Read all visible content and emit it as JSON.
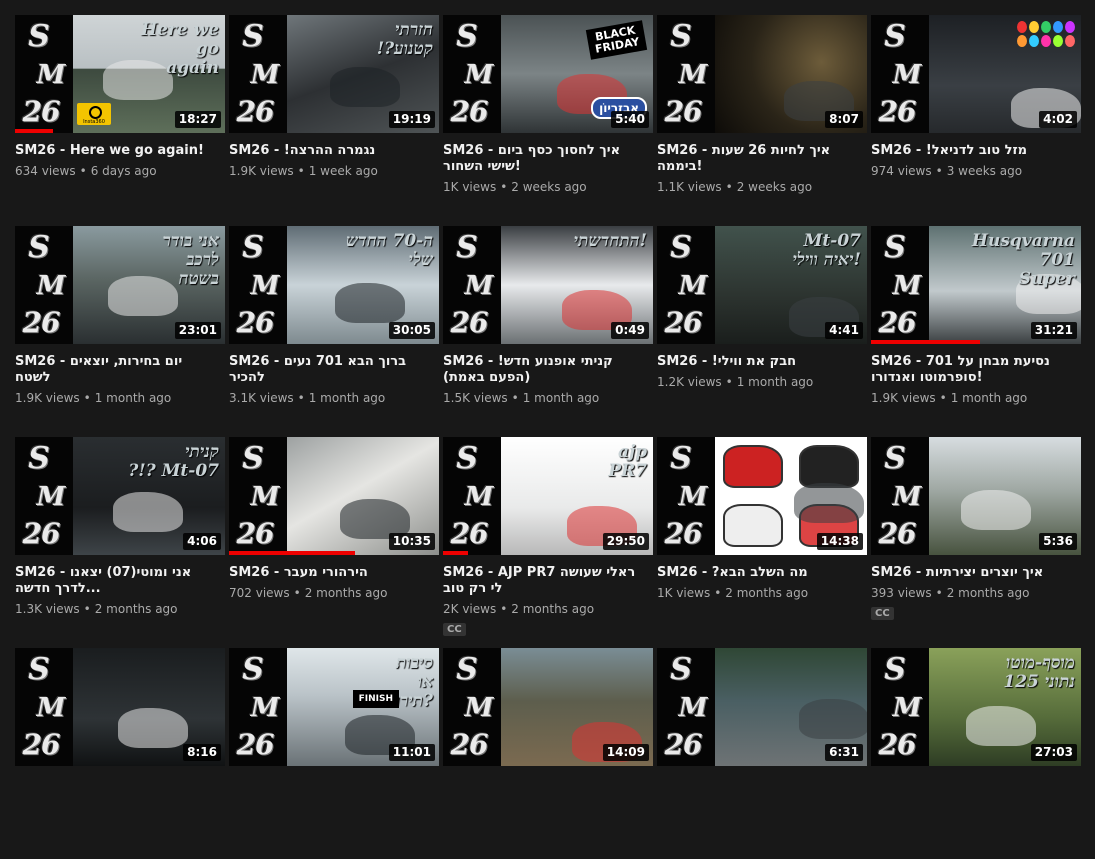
{
  "videos": [
    {
      "title": "SM26 - Here we go again!",
      "views": "634 views",
      "age": "6 days ago",
      "duration": "18:27",
      "overlay": "Here we\ngo\nagain",
      "extra": "insta",
      "cc": false
    },
    {
      "title": "SM26 - !נגמרה ההרצה",
      "views": "1.9K views",
      "age": "1 week ago",
      "duration": "19:19",
      "overlay": "חזרתי\n!?קטנוע",
      "cc": false
    },
    {
      "title": "SM26 - איך לחסוך כסף ביום שישי השחור!",
      "views": "1K views",
      "age": "2 weeks ago",
      "duration": "5:40",
      "overlay": "",
      "extra": "blackfriday",
      "bf_text": "BLACK\nFRIDAY",
      "brand": "אבזריוֹן",
      "cc": false
    },
    {
      "title": "SM26 - איך לחיות 26 שעות ביממה!",
      "views": "1.1K views",
      "age": "2 weeks ago",
      "duration": "8:07",
      "overlay": "",
      "cc": false
    },
    {
      "title": "SM26 - !מזל טוב לדניאל",
      "views": "974 views",
      "age": "3 weeks ago",
      "duration": "4:02",
      "overlay": "",
      "extra": "balloons",
      "cc": false
    },
    {
      "title": "SM26 - יום בחירות, יוצאים לשטח",
      "views": "1.9K views",
      "age": "1 month ago",
      "duration": "23:01",
      "overlay": "אני בודר\nלרכב\nבשטח",
      "cc": false
    },
    {
      "title": "SM26 - ברוך הבא 701 נעים להכיר",
      "views": "3.1K views",
      "age": "1 month ago",
      "duration": "30:05",
      "overlay": "ה-70 החדש\nשלי",
      "cc": false
    },
    {
      "title": "SM26 - קניתי אופנוע חדש! (הפעם באמת)",
      "views": "1.5K views",
      "age": "1 month ago",
      "duration": "0:49",
      "overlay": "התחדשתי!",
      "cc": false
    },
    {
      "title": "SM26 - !חבק את ווילי",
      "views": "1.2K views",
      "age": "1 month ago",
      "duration": "4:41",
      "overlay": "Mt-07\nיאיה ווילי!",
      "cc": false
    },
    {
      "title": "SM26 - נסיעת מבחן על 701 סופרמוטו ואנדורו!",
      "views": "1.9K views",
      "age": "1 month ago",
      "duration": "31:21",
      "overlay": "Husqvarna\n701\nSuper",
      "cc": false
    },
    {
      "title": "SM26 - אני ומוטי(07) יצאנו לדרך חדשה...",
      "views": "1.3K views",
      "age": "2 months ago",
      "duration": "4:06",
      "overlay": "קניתי\n?!? Mt-07",
      "cc": false
    },
    {
      "title": "SM26 - הירהורי מעבר",
      "views": "702 views",
      "age": "2 months ago",
      "duration": "10:35",
      "overlay": "",
      "cc": false
    },
    {
      "title": "SM26 - AJP PR7 ראלי שעושה לי רק טוב",
      "views": "2K views",
      "age": "2 months ago",
      "duration": "29:50",
      "overlay": "ajp\nPR7",
      "cc": true
    },
    {
      "title": "SM26 - ?מה השלב הבא",
      "views": "1K views",
      "age": "2 months ago",
      "duration": "14:38",
      "overlay": "",
      "extra": "bikes",
      "cc": false
    },
    {
      "title": "SM26 - איך יוצרים יצירתיות",
      "views": "393 views",
      "age": "2 months ago",
      "duration": "5:36",
      "overlay": "",
      "cc": true
    },
    {
      "title": "",
      "views": "",
      "age": "",
      "duration": "8:16",
      "overlay": "",
      "cc": false
    },
    {
      "title": "",
      "views": "",
      "age": "",
      "duration": "11:01",
      "overlay": "סיבות\nאו\nתירוצים?",
      "extra": "finish",
      "finish_text": "FINISH",
      "cc": false
    },
    {
      "title": "",
      "views": "",
      "age": "",
      "duration": "14:09",
      "overlay": "",
      "cc": false
    },
    {
      "title": "",
      "views": "",
      "age": "",
      "duration": "6:31",
      "overlay": "",
      "cc": false
    },
    {
      "title": "",
      "views": "",
      "age": "",
      "duration": "27:03",
      "overlay": "מוסף-מוטו\n125 נתוני",
      "cc": false
    }
  ],
  "logo": {
    "line1": "S",
    "line2": "M",
    "line3": "26"
  },
  "insta_label": "Insta360",
  "cc_label": "CC",
  "colors": {
    "background": "#181818",
    "title": "#f1f1f1",
    "meta": "#aaaaaa",
    "progress": "#ee0000",
    "duration_bg": "#000000"
  }
}
